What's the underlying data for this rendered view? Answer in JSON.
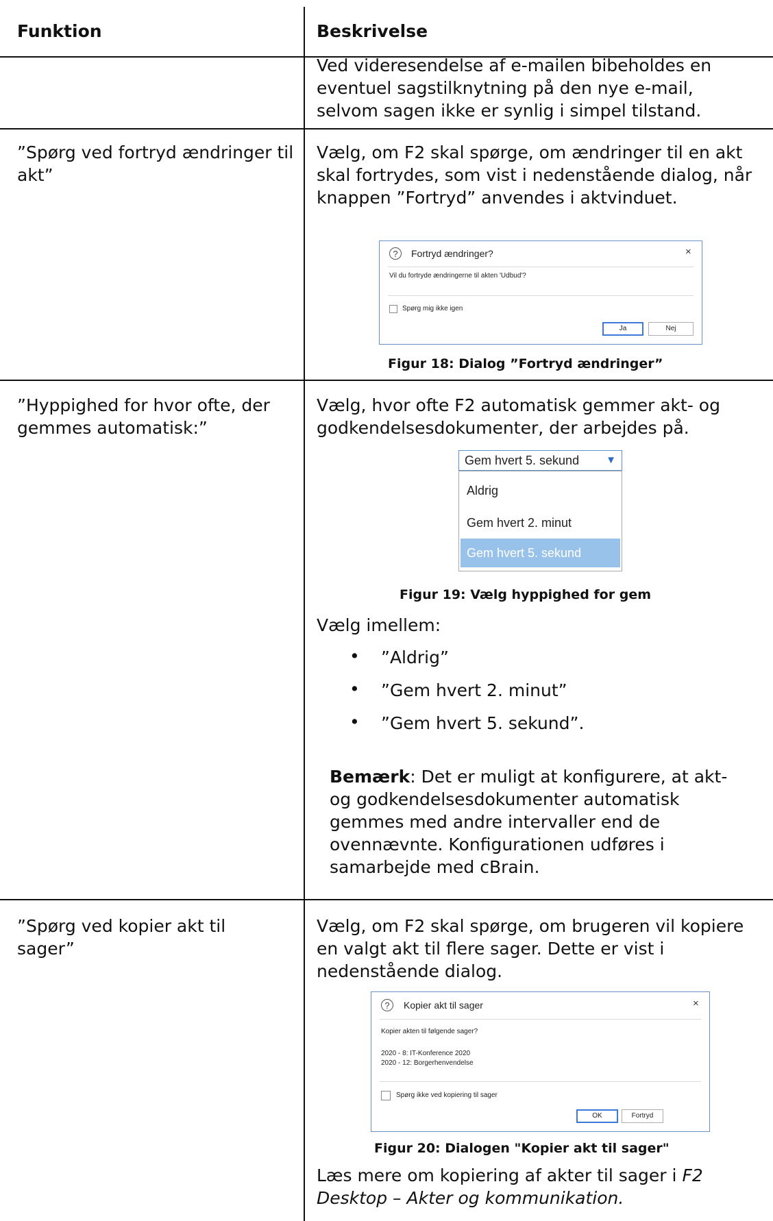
{
  "table": {
    "header": {
      "col1": "Funktion",
      "col2": "Beskrivelse"
    },
    "row0": {
      "desc": "Ved videresendelse af e-mailen bibeholdes en eventuel sagstilknytning på den nye e-mail, selvom sagen ikke er synlig i simpel tilstand."
    },
    "row1": {
      "func": "”Spørg ved fortryd ændringer til akt”",
      "desc": "Vælg, om F2 skal spørge, om ændringer til en akt skal fortrydes, som vist i nedenstående dialog, når knappen ”Fortryd” anvendes i aktvinduet.",
      "figure": {
        "title": "Fortryd ændringer?",
        "close": "×",
        "question_icon": "?",
        "message": "Vil du fortryde ændringerne til akten 'Udbud'?",
        "checkbox_label": "Spørg mig ikke igen",
        "btn_yes": "Ja",
        "btn_no": "Nej"
      },
      "caption": "Figur 18: Dialog ”Fortryd ændringer”"
    },
    "row2": {
      "func": "”Hyppighed for hvor ofte, der gemmes automatisk:”",
      "desc": "Vælg, hvor ofte F2 automatisk gemmer akt- og godkendelsesdokumenter, der arbejdes på.",
      "dropdown": {
        "selected": "Gem hvert 5. sekund",
        "arrow": "▼",
        "options": [
          "Aldrig",
          "Gem hvert 2. minut",
          "Gem hvert 5. sekund"
        ],
        "highlight_color": "#99c2ea"
      },
      "caption": "Figur 19: Vælg hyppighed for gem",
      "choose": "Vælg imellem:",
      "bullet": "•",
      "bullets": [
        "”Aldrig”",
        "”Gem hvert 2. minut”",
        "”Gem hvert 5. sekund”."
      ],
      "note_bold": "Bemærk",
      "note_rest": ": Det er muligt at konfigurere, at akt-og godkendelsesdokumenter automatisk gemmes med andre intervaller end de ovennævnte. Konfigurationen udføres i samarbejde med cBrain."
    },
    "row3": {
      "func": "”Spørg ved kopier akt til sager”",
      "desc": "Vælg, om F2 skal spørge, om brugeren vil kopiere en valgt akt til flere sager. Dette er vist i nedenstående dialog.",
      "figure": {
        "title": "Kopier akt til sager",
        "close": "×",
        "question_icon": "?",
        "message": "Kopier akten til følgende sager?",
        "cases": "2020 - 8: IT-Konference 2020\n2020 - 12: Borgerhenvendelse",
        "checkbox_label": "Spørg ikke ved kopiering til sager",
        "btn_ok": "OK",
        "btn_cancel": "Fortryd"
      },
      "caption": "Figur 20: Dialogen \"Kopier akt til sager\"",
      "more_prefix": "Læs mere om kopiering af akter til sager i ",
      "more_ref": "F2 Desktop – Akter og kommunikation."
    }
  }
}
